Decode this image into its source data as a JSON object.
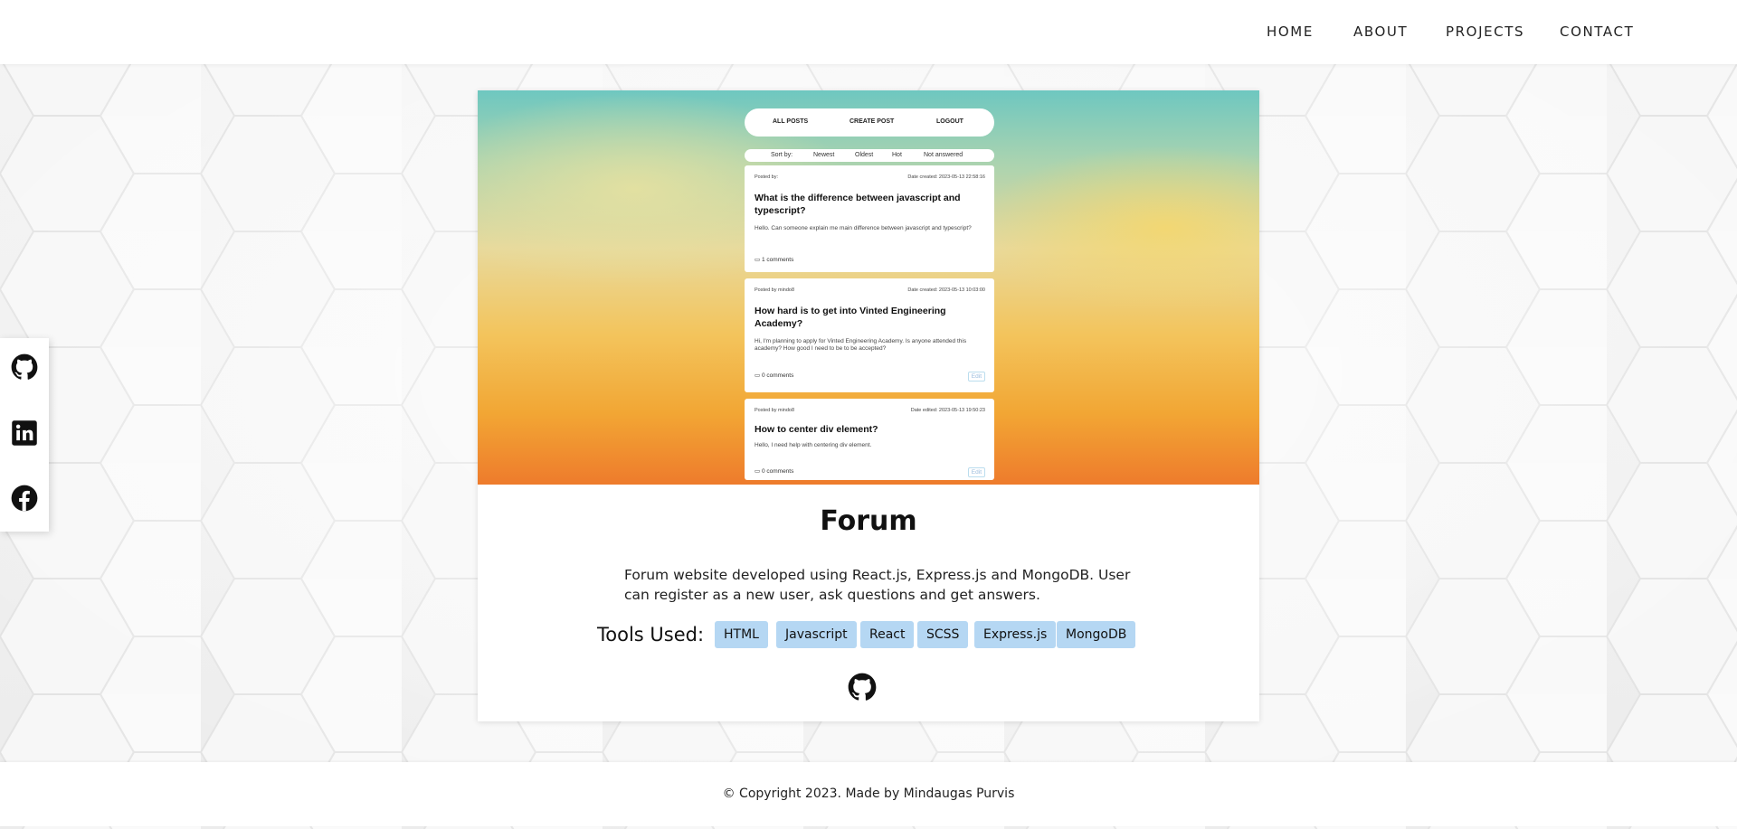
{
  "nav": {
    "links": [
      "HOME",
      "ABOUT",
      "PROJECTS",
      "CONTACT"
    ]
  },
  "social": {
    "icons": [
      "github-icon",
      "linkedin-icon",
      "facebook-icon"
    ]
  },
  "project": {
    "title": "Forum",
    "description": "Forum website developed using React.js, Express.js and MongoDB. User can register as a new user, ask questions and get answers.",
    "tools_label": "Tools Used:",
    "tools": [
      "HTML",
      "Javascript",
      "React",
      "SCSS",
      "Express.js",
      "MongoDB"
    ],
    "repo_icon": "github-icon"
  },
  "preview": {
    "nav": [
      "ALL POSTS",
      "CREATE POST",
      "LOGOUT"
    ],
    "sort_label": "Sort by:",
    "sort_options": [
      "Newest",
      "Oldest",
      "Hot",
      "Not answered"
    ],
    "posts": [
      {
        "posted_by": "Posted by:",
        "date": "Date created: 2023-05-13 22:58:16",
        "title": "What is the difference between javascript and typescript?",
        "body": "Hello. Can someone explain me main difference between javascript and typescript?",
        "comments": "1 comments",
        "edit": ""
      },
      {
        "posted_by": "Posted by mindo8",
        "date": "Date created: 2023-05-13 10:03:00",
        "title": "How hard is to get into Vinted Engineering Academy?",
        "body": "Hi, I'm planning to apply for Vinted Engineering Academy. Is anyone attended this academy? How good I need to be to be accepted?",
        "comments": "0 comments",
        "edit": "Edit"
      },
      {
        "posted_by": "Posted by mindo8",
        "date": "Date edited: 2023-05-13 19:50:23",
        "title": "How to center div element?",
        "body": "Hello, I need help with centering div element.",
        "comments": "0 comments",
        "edit": "Edit"
      }
    ]
  },
  "footer": {
    "copyright": "© Copyright 2023. Made by Mindaugas Purvis"
  }
}
